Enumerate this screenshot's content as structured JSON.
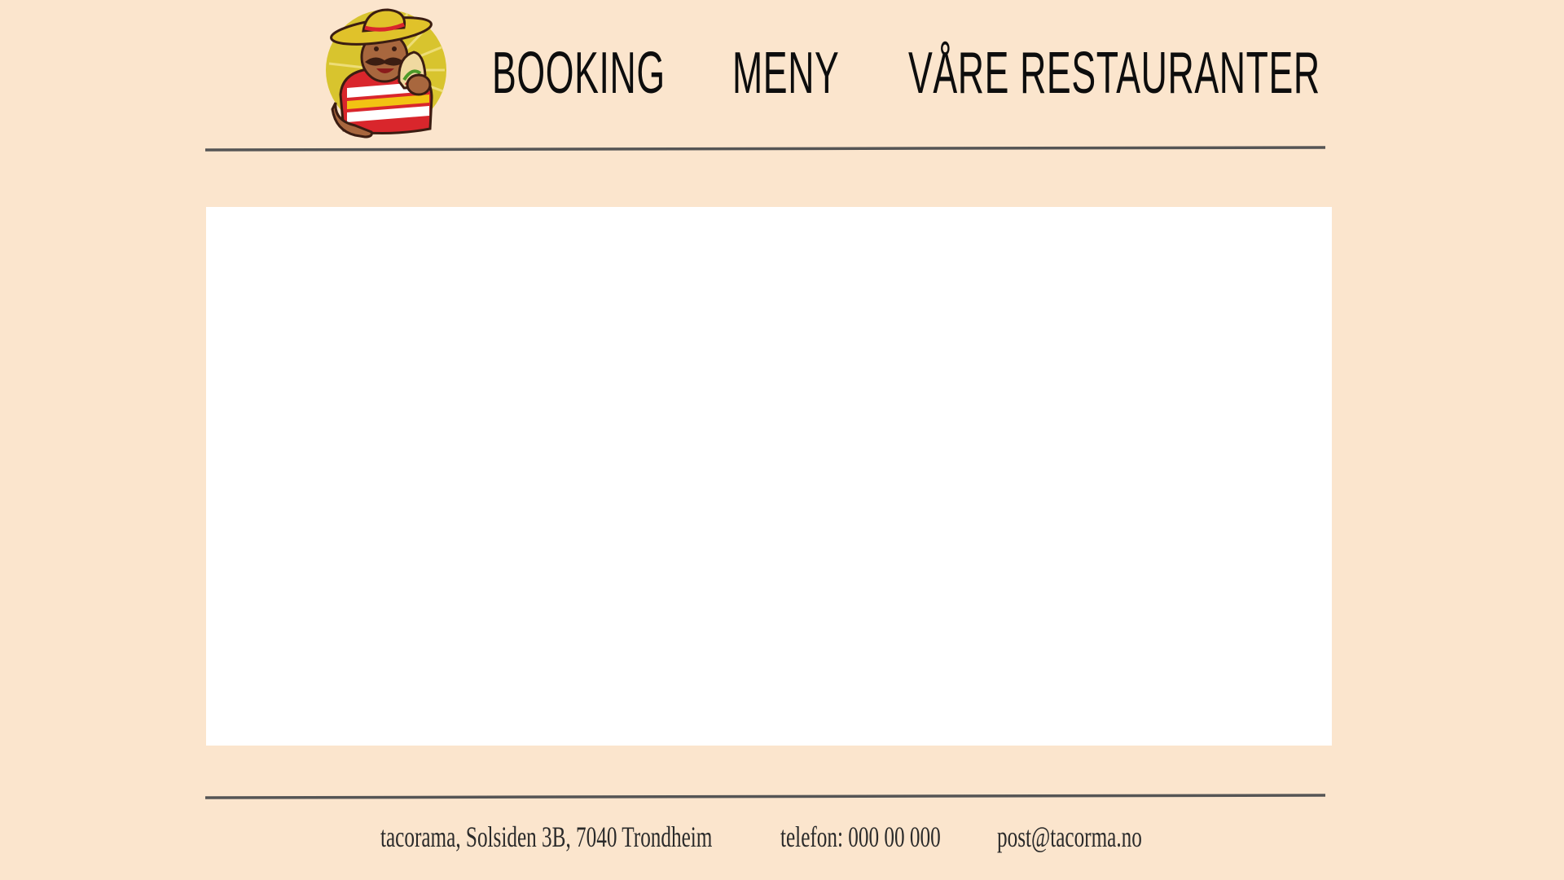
{
  "header": {
    "logo": {
      "icon": "taco-mascot-icon",
      "colors": {
        "sunburst": "#d8c42e",
        "sombrero": "#e0c22a",
        "shirt_red": "#d9262c",
        "shirt_white": "#ffffff",
        "shirt_yellow": "#f2c313",
        "skin": "#a8673e",
        "outline": "#3b1d12"
      }
    },
    "nav": {
      "booking": "BOOKING",
      "meny": "MENY",
      "restauranter": "VÅRE RESTAURANTER"
    }
  },
  "main": {
    "frame_background": "#ffffff"
  },
  "footer": {
    "address": "tacorama, Solsiden 3B, 7040 Trondheim",
    "phone": "telefon: 000 00 000",
    "email": "post@tacorma.no"
  },
  "colors": {
    "page_background": "#fbe5cd",
    "rule": "#555555",
    "text": "#111111"
  }
}
